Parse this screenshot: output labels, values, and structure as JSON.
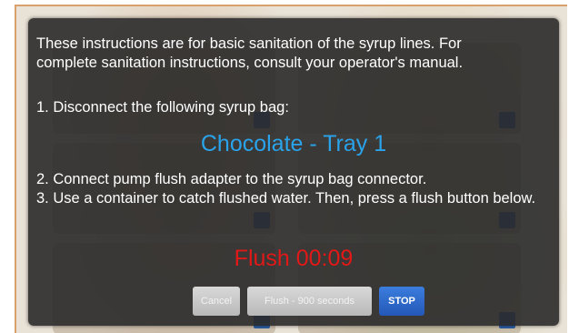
{
  "dialog": {
    "intro_line1": "These instructions are for basic sanitation of the syrup lines. For",
    "intro_line2": "complete sanitation instructions, consult your operator's manual.",
    "step1": "1. Disconnect the following syrup bag:",
    "syrup_bag": "Chocolate - Tray 1",
    "step2": "2. Connect pump flush adapter to the syrup bag connector.",
    "step3": "3. Use a container to catch flushed water. Then, press a flush button below.",
    "timer": "Flush 00:09"
  },
  "buttons": {
    "cancel": "Cancel",
    "flush": "Flush - 900 seconds",
    "stop": "STOP"
  },
  "colors": {
    "syrup_text": "#2aa3ea",
    "timer_text": "#e11818",
    "stop_button": "#2458b8",
    "frame_border": "#d8a06a"
  }
}
